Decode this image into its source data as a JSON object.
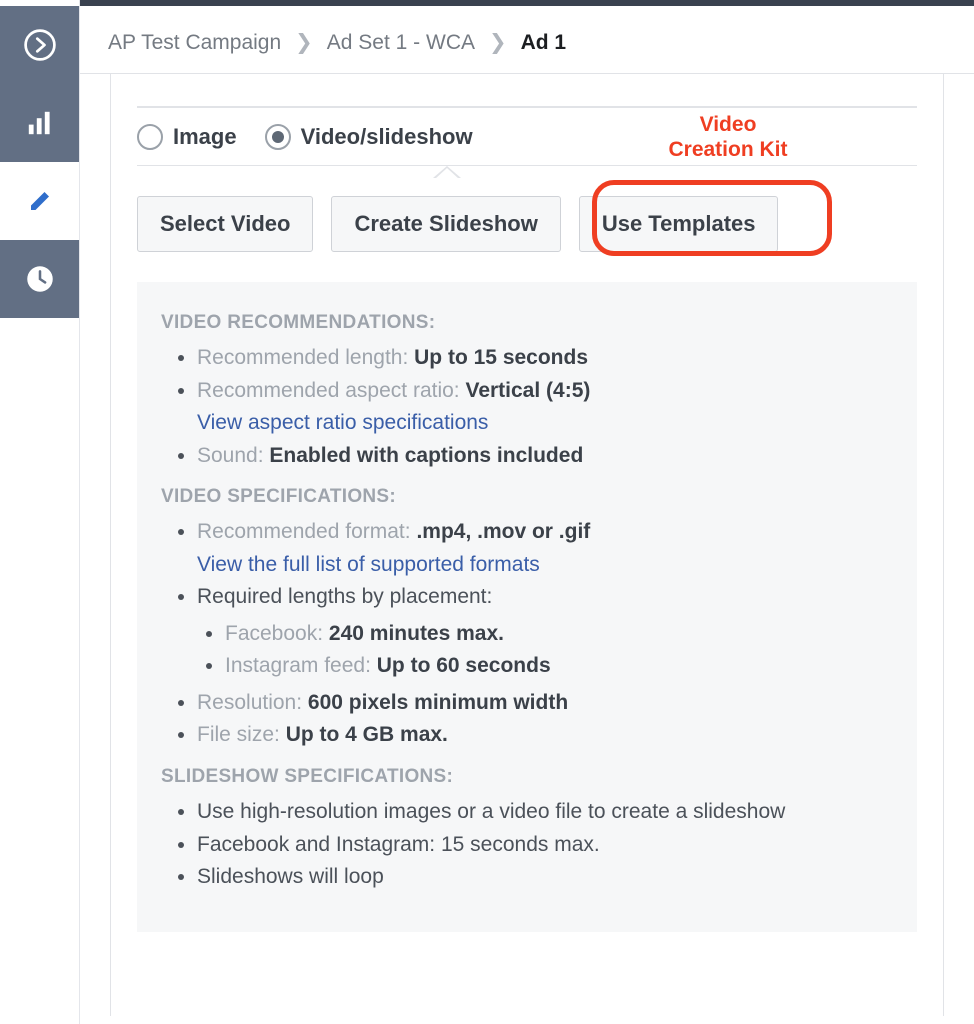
{
  "breadcrumb": {
    "campaign": "AP Test Campaign",
    "adset": "Ad Set 1 - WCA",
    "ad": "Ad 1"
  },
  "tabs": {
    "image": "Image",
    "video": "Video/slideshow"
  },
  "buttons": {
    "select_video": "Select Video",
    "create_slideshow": "Create Slideshow",
    "use_templates": "Use Templates"
  },
  "annotation": "Video\nCreation Kit",
  "recs": {
    "heading": "VIDEO RECOMMENDATIONS:",
    "length_label": "Recommended length: ",
    "length_value": "Up to 15 seconds",
    "aspect_label": "Recommended aspect ratio: ",
    "aspect_value": "Vertical (4:5)",
    "aspect_link": "View aspect ratio specifications",
    "sound_label": "Sound: ",
    "sound_value": "Enabled with captions included"
  },
  "specs": {
    "heading": "VIDEO SPECIFICATIONS:",
    "format_label": "Recommended format: ",
    "format_value": ".mp4, .mov or .gif",
    "format_link": "View the full list of supported formats",
    "required_label": "Required lengths by placement:",
    "fb_label": "Facebook: ",
    "fb_value": "240 minutes max.",
    "ig_label": "Instagram feed: ",
    "ig_value": "Up to 60 seconds",
    "res_label": "Resolution: ",
    "res_value": "600 pixels minimum width",
    "size_label": "File size: ",
    "size_value": "Up to 4 GB max."
  },
  "slideshow": {
    "heading": "SLIDESHOW SPECIFICATIONS:",
    "item1": "Use high-resolution images or a video file to create a slideshow",
    "item2": "Facebook and Instagram: 15 seconds max.",
    "item3": "Slideshows will loop"
  }
}
